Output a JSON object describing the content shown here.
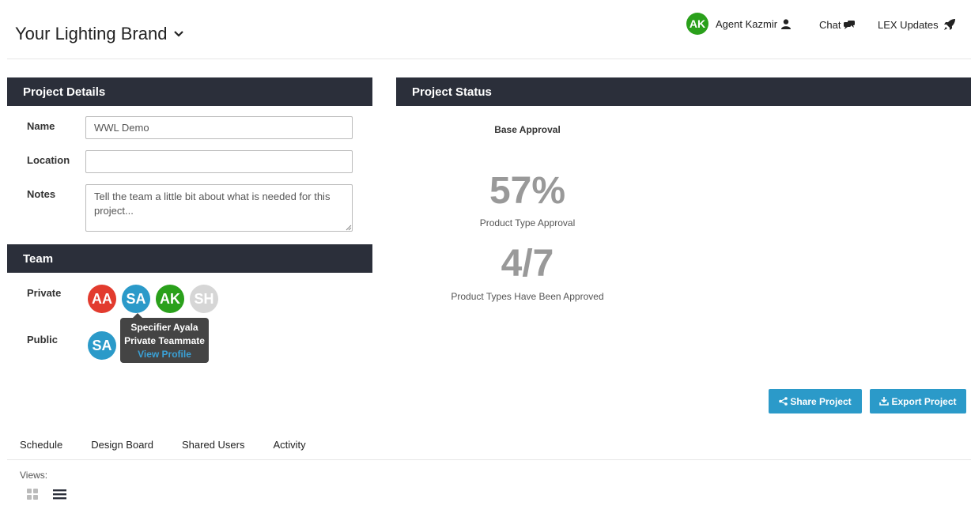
{
  "header": {
    "brand": "Your Lighting Brand",
    "user_initials": "AK",
    "user_name": "Agent Kazmir",
    "chat_label": "Chat",
    "updates_label": "LEX Updates"
  },
  "details": {
    "title": "Project Details",
    "name_label": "Name",
    "name_value": "WWL Demo",
    "location_label": "Location",
    "location_value": "",
    "notes_label": "Notes",
    "notes_placeholder": "Tell the team a little bit about what is needed for this project..."
  },
  "team": {
    "title": "Team",
    "private_label": "Private",
    "public_label": "Public",
    "private_members": [
      {
        "initials": "AA",
        "color": "#e23b2e"
      },
      {
        "initials": "SA",
        "color": "#2b9ac9"
      },
      {
        "initials": "AK",
        "color": "#2aa01b"
      },
      {
        "initials": "SH",
        "color": "#d6d6d6"
      }
    ],
    "public_members": [
      {
        "initials": "SA",
        "color": "#2b9ac9"
      }
    ],
    "tooltip": {
      "name": "Specifier Ayala",
      "role": "Private Teammate",
      "link": "View Profile"
    }
  },
  "status": {
    "title": "Project Status",
    "base_label": "Base Approval",
    "percent": "57%",
    "percent_label": "Product Type Approval",
    "fraction": "4/7",
    "fraction_label": "Product Types Have Been Approved"
  },
  "actions": {
    "share": "Share Project",
    "export": "Export Project"
  },
  "tabs": [
    "Schedule",
    "Design Board",
    "Shared Users",
    "Activity"
  ],
  "views_label": "Views:",
  "colors": {
    "header_dark": "#2b2f3a",
    "accent": "#2b9ac9"
  }
}
